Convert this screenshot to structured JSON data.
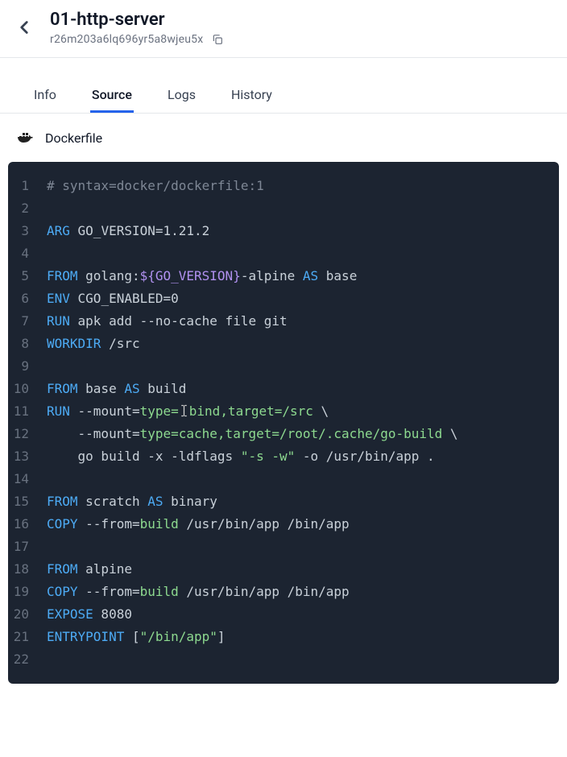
{
  "header": {
    "title": "01-http-server",
    "subtitle_id": "r26m203a6lq696yr5a8wjeu5x"
  },
  "tabs": {
    "items": [
      {
        "label": "Info"
      },
      {
        "label": "Source"
      },
      {
        "label": "Logs"
      },
      {
        "label": "History"
      }
    ],
    "active_index": 1
  },
  "file": {
    "icon": "docker-icon",
    "name": "Dockerfile"
  },
  "code": {
    "lines": [
      [
        {
          "t": "comment",
          "v": "# syntax=docker/dockerfile:1"
        }
      ],
      [],
      [
        {
          "t": "kw",
          "v": "ARG"
        },
        {
          "t": "plain",
          "v": " GO_VERSION=1.21.2"
        }
      ],
      [],
      [
        {
          "t": "kw",
          "v": "FROM"
        },
        {
          "t": "plain",
          "v": " golang:"
        },
        {
          "t": "var",
          "v": "${GO_VERSION}"
        },
        {
          "t": "plain",
          "v": "-alpine "
        },
        {
          "t": "kw",
          "v": "AS"
        },
        {
          "t": "plain",
          "v": " base"
        }
      ],
      [
        {
          "t": "kw",
          "v": "ENV"
        },
        {
          "t": "plain",
          "v": " CGO_ENABLED=0"
        }
      ],
      [
        {
          "t": "kw",
          "v": "RUN"
        },
        {
          "t": "plain",
          "v": " apk add --no-cache file git"
        }
      ],
      [
        {
          "t": "kw",
          "v": "WORKDIR"
        },
        {
          "t": "plain",
          "v": " /src"
        }
      ],
      [],
      [
        {
          "t": "kw",
          "v": "FROM"
        },
        {
          "t": "plain",
          "v": " base "
        },
        {
          "t": "kw",
          "v": "AS"
        },
        {
          "t": "plain",
          "v": " build"
        }
      ],
      [
        {
          "t": "kw",
          "v": "RUN"
        },
        {
          "t": "plain",
          "v": " --mount="
        },
        {
          "t": "str",
          "v": "type="
        },
        {
          "t": "cursor",
          "v": ""
        },
        {
          "t": "str",
          "v": "bind,target=/src"
        },
        {
          "t": "plain",
          "v": " \\"
        }
      ],
      [
        {
          "t": "plain",
          "v": "    --mount="
        },
        {
          "t": "str",
          "v": "type=cache,target=/root/.cache/go-build"
        },
        {
          "t": "plain",
          "v": " \\"
        }
      ],
      [
        {
          "t": "plain",
          "v": "    go build -x -ldflags "
        },
        {
          "t": "str",
          "v": "\"-s -w\""
        },
        {
          "t": "plain",
          "v": " -o /usr/bin/app ."
        }
      ],
      [],
      [
        {
          "t": "kw",
          "v": "FROM"
        },
        {
          "t": "plain",
          "v": " scratch "
        },
        {
          "t": "kw",
          "v": "AS"
        },
        {
          "t": "plain",
          "v": " binary"
        }
      ],
      [
        {
          "t": "kw",
          "v": "COPY"
        },
        {
          "t": "plain",
          "v": " --from="
        },
        {
          "t": "str",
          "v": "build"
        },
        {
          "t": "plain",
          "v": " /usr/bin/app /bin/app"
        }
      ],
      [],
      [
        {
          "t": "kw",
          "v": "FROM"
        },
        {
          "t": "plain",
          "v": " alpine"
        }
      ],
      [
        {
          "t": "kw",
          "v": "COPY"
        },
        {
          "t": "plain",
          "v": " --from="
        },
        {
          "t": "str",
          "v": "build"
        },
        {
          "t": "plain",
          "v": " /usr/bin/app /bin/app"
        }
      ],
      [
        {
          "t": "kw",
          "v": "EXPOSE"
        },
        {
          "t": "plain",
          "v": " 8080"
        }
      ],
      [
        {
          "t": "kw",
          "v": "ENTRYPOINT"
        },
        {
          "t": "plain",
          "v": " ["
        },
        {
          "t": "str",
          "v": "\"/bin/app\""
        },
        {
          "t": "plain",
          "v": "]"
        }
      ],
      []
    ]
  }
}
